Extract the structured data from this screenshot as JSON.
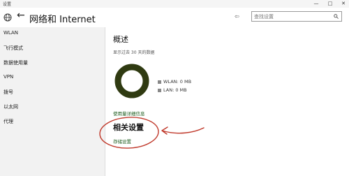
{
  "window": {
    "title": "设置",
    "controls": {
      "minimize": "—",
      "maximize": "□",
      "close": "✕"
    }
  },
  "header": {
    "title": "网络和 Internet",
    "back_icon": "←",
    "pin_icon": "⇦",
    "search_placeholder": "查找设置"
  },
  "sidebar": {
    "items": [
      {
        "label": "WLAN"
      },
      {
        "label": "飞行模式"
      },
      {
        "label": "数据使用量"
      },
      {
        "label": "VPN"
      },
      {
        "label": "拨号"
      },
      {
        "label": "以太网"
      },
      {
        "label": "代理"
      }
    ]
  },
  "main": {
    "overview_title": "概述",
    "period_text": "显示过去 30 天的数据",
    "legend": [
      {
        "label": "WLAN: 0 MB"
      },
      {
        "label": "LAN: 0 MB"
      }
    ],
    "usage_details_link": "使用量详细信息",
    "related_title": "相关设置",
    "storage_link": "存储设置"
  },
  "colors": {
    "donut": "#2f3a11",
    "annotation": "#c0392b",
    "link": "#1a5a1a"
  }
}
